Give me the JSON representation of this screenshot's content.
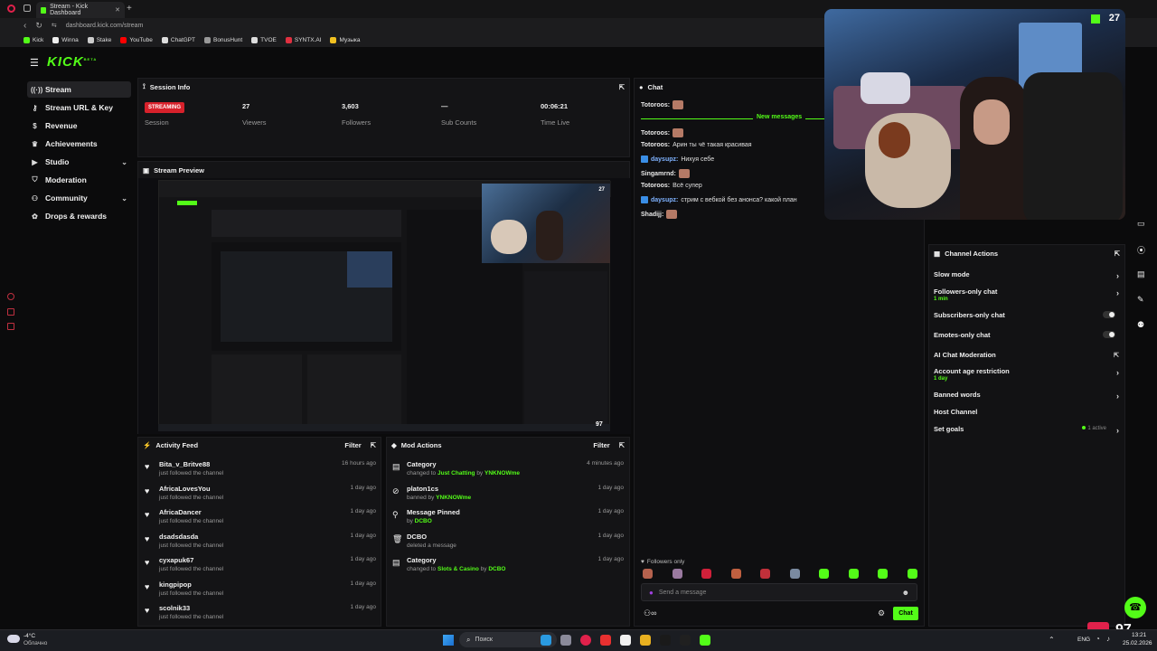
{
  "browser": {
    "tab_title": "Stream - Kick Dashboard",
    "url": "dashboard.kick.com/stream",
    "bookmarks": [
      {
        "label": "Kick",
        "color": "#53fc18"
      },
      {
        "label": "Winna",
        "color": "#eeeeee"
      },
      {
        "label": "Stake",
        "color": "#cccccc"
      },
      {
        "label": "YouTube",
        "color": "#ff0000"
      },
      {
        "label": "ChatGPT",
        "color": "#dddddd"
      },
      {
        "label": "BonusHunt",
        "color": "#999999"
      },
      {
        "label": "TVOE",
        "color": "#dddddd"
      },
      {
        "label": "SYNTX.AI",
        "color": "#e03040"
      },
      {
        "label": "Музыка",
        "color": "#f0c020"
      }
    ]
  },
  "app": {
    "logo": "KICK",
    "logo_sup": "BETA",
    "accent": "#53fc18"
  },
  "sidebar": {
    "items": [
      {
        "label": "Stream",
        "icon": "broadcast-icon"
      },
      {
        "label": "Stream URL & Key",
        "icon": "key-icon"
      },
      {
        "label": "Revenue",
        "icon": "dollar-icon"
      },
      {
        "label": "Achievements",
        "icon": "trophy-icon"
      },
      {
        "label": "Studio",
        "icon": "video-icon"
      },
      {
        "label": "Moderation",
        "icon": "shield-icon"
      },
      {
        "label": "Community",
        "icon": "users-icon"
      },
      {
        "label": "Drops & rewards",
        "icon": "gift-icon"
      }
    ]
  },
  "session": {
    "title": "Session Info",
    "status_badge": "STREAMING",
    "status_label": "Session",
    "stats": [
      {
        "value": "27",
        "label": "Viewers"
      },
      {
        "value": "3,603",
        "label": "Followers"
      },
      {
        "value": "—",
        "label": "Sub Counts"
      },
      {
        "value": "00:06:21",
        "label": "Time Live"
      }
    ]
  },
  "preview": {
    "title": "Stream Preview",
    "viewer_count": "27",
    "bottom_count": "97"
  },
  "activity": {
    "title": "Activity Feed",
    "filter": "Filter",
    "items": [
      {
        "name": "Bita_v_Britve88",
        "sub": "just followed the channel",
        "time": "16 hours ago"
      },
      {
        "name": "AfricaLovesYou",
        "sub": "just followed the channel",
        "time": "1 day ago"
      },
      {
        "name": "AfricaDancer",
        "sub": "just followed the channel",
        "time": "1 day ago"
      },
      {
        "name": "dsadsdasda",
        "sub": "just followed the channel",
        "time": "1 day ago"
      },
      {
        "name": "cyxapuk67",
        "sub": "just followed the channel",
        "time": "1 day ago"
      },
      {
        "name": "kingpipop",
        "sub": "just followed the channel",
        "time": "1 day ago"
      },
      {
        "name": "scolnik33",
        "sub": "just followed the channel",
        "time": "1 day ago"
      }
    ]
  },
  "mod": {
    "title": "Mod Actions",
    "filter": "Filter",
    "items": [
      {
        "title": "Category",
        "pre": "changed to ",
        "hl1": "Just Chatting",
        "mid": " by ",
        "hl2": "YNKNOWme",
        "time": "4 minutes ago",
        "icon": "category-icon"
      },
      {
        "title": "platon1cs",
        "pre": "banned by ",
        "hl1": "YNKNOWme",
        "mid": "",
        "hl2": "",
        "time": "1 day ago",
        "icon": "ban-icon"
      },
      {
        "title": "Message Pinned",
        "pre": "by ",
        "hl1": "DCBO",
        "mid": "",
        "hl2": "",
        "time": "1 day ago",
        "icon": "pin-icon"
      },
      {
        "title": "DCBO",
        "pre": "deleted a message",
        "hl1": "",
        "mid": "",
        "hl2": "",
        "time": "1 day ago",
        "icon": "trash-icon"
      },
      {
        "title": "Category",
        "pre": "changed to ",
        "hl1": "Slots & Casino",
        "mid": " by ",
        "hl2": "DCBO",
        "time": "1 day ago",
        "icon": "category-icon"
      }
    ]
  },
  "chat": {
    "title": "Chat",
    "new_messages": "New messages",
    "messages": [
      {
        "user": "Totoroos:",
        "text": "",
        "emote": true,
        "badge": false,
        "color": "#e8e8e8"
      },
      {
        "user": "Totoroos:",
        "text": "",
        "emote": true,
        "badge": false,
        "color": "#e8e8e8"
      },
      {
        "user": "Totoroos:",
        "text": "Арин ты чё такая красивая",
        "emote": false,
        "badge": false,
        "color": "#e8e8e8"
      },
      {
        "user": "daysupz:",
        "text": "Нихуя себе",
        "emote": false,
        "badge": true,
        "color": "#7fb2ff"
      },
      {
        "user": "Singamrnd:",
        "text": "",
        "emote": true,
        "badge": false,
        "color": "#e8e8e8"
      },
      {
        "user": "Totoroos:",
        "text": "Всё супер",
        "emote": false,
        "badge": false,
        "color": "#e8e8e8"
      },
      {
        "user": "daysupz:",
        "text": "стрим с вебкой без анонса? какой план",
        "emote": false,
        "badge": true,
        "color": "#7fb2ff"
      },
      {
        "user": "Shadijj:",
        "text": "",
        "emote": true,
        "badge": false,
        "color": "#e8e8e8"
      }
    ],
    "followers_only": "Followers only",
    "placeholder": "Send a message",
    "send_label": "Chat"
  },
  "channel_actions": {
    "title": "Channel Actions",
    "items": [
      {
        "label": "Slow mode",
        "sub": "",
        "control": "chevron"
      },
      {
        "label": "Followers-only chat",
        "sub": "1 min",
        "control": "chevron"
      },
      {
        "label": "Subscribers-only chat",
        "sub": "",
        "control": "toggle"
      },
      {
        "label": "Emotes-only chat",
        "sub": "",
        "control": "toggle"
      },
      {
        "label": "AI Chat Moderation",
        "sub": "",
        "control": "external"
      },
      {
        "label": "Account age restriction",
        "sub": "1 day",
        "control": "chevron"
      },
      {
        "label": "Banned words",
        "sub": "",
        "control": "chevron"
      },
      {
        "label": "Host Channel",
        "sub": "",
        "control": "none"
      },
      {
        "label": "Set goals",
        "sub": "",
        "control": "chevron"
      }
    ],
    "goals_active": "1 active"
  },
  "webcam": {
    "viewer_count": "27"
  },
  "taskbar": {
    "weather_temp": "-4°C",
    "weather_desc": "Облачно",
    "search_placeholder": "Поиск",
    "lang": "ENG",
    "time": "13:21",
    "date": "25.02.2026",
    "overlay_count": "97"
  }
}
